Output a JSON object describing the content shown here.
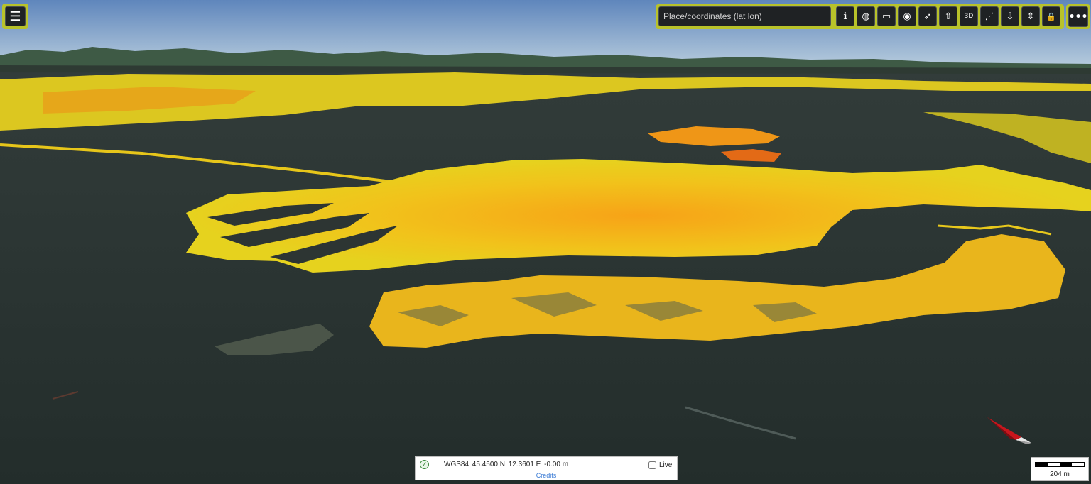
{
  "search": {
    "placeholder": "Place/coordinates (lat lon)"
  },
  "menu": {
    "icon": "hamburger-menu-icon",
    "glyph": "☰"
  },
  "toolbar": {
    "buttons": [
      {
        "name": "info-icon",
        "glyph": "ℹ"
      },
      {
        "name": "globe-icon",
        "glyph": "◍"
      },
      {
        "name": "ruler-icon",
        "glyph": "▭"
      },
      {
        "name": "target-icon",
        "glyph": "◉"
      },
      {
        "name": "compass-icon",
        "glyph": "➶"
      },
      {
        "name": "share-icon",
        "glyph": "⇧"
      },
      {
        "name": "3d-view-icon",
        "glyph": "3D"
      },
      {
        "name": "network-icon",
        "glyph": "⋰"
      },
      {
        "name": "download-icon",
        "glyph": "⇩"
      },
      {
        "name": "upload-download-icon",
        "glyph": "⇕"
      },
      {
        "name": "lock-icon",
        "glyph": "🔒"
      }
    ],
    "more_glyph": "•••"
  },
  "status": {
    "datum": "WGS84",
    "lat": "45.4500 N",
    "lon": "12.3601 E",
    "elev": "-0.00 m",
    "credits": "Credits",
    "live_label": "Live",
    "verified_glyph": "✓"
  },
  "scale": {
    "label": "204 m"
  },
  "colors": {
    "sky_top": "#5f86bc",
    "sky_bottom": "#b9cbdd",
    "water": "#27312f",
    "toolbar_accent": "#b8c22a",
    "points_yellow": "#f0d21a",
    "points_orange": "#eb8a16",
    "points_red": "#d63c14",
    "points_green": "#7cc83a"
  }
}
